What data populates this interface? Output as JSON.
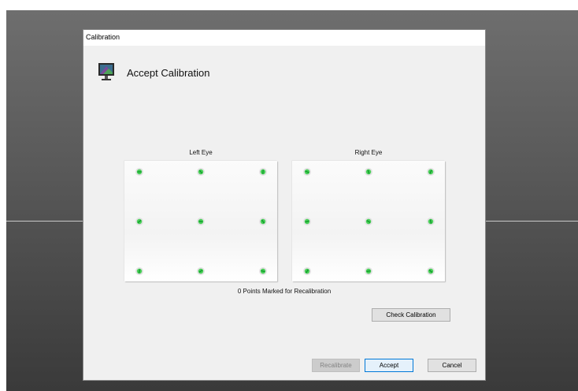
{
  "window": {
    "title": "Calibration"
  },
  "header": {
    "title": "Accept Calibration",
    "icon": "monitor-icon"
  },
  "panels": {
    "left": {
      "label": "Left Eye"
    },
    "right": {
      "label": "Right Eye"
    }
  },
  "status": {
    "text": "0 Points Marked for Recalibration"
  },
  "buttons": {
    "check_calibration": "Check Calibration",
    "recalibrate": "Recalibrate",
    "accept": "Accept",
    "cancel": "Cancel"
  },
  "colors": {
    "point": "#2ecc40",
    "point_halo": "#e2e2e2",
    "accent": "#0078d7"
  }
}
